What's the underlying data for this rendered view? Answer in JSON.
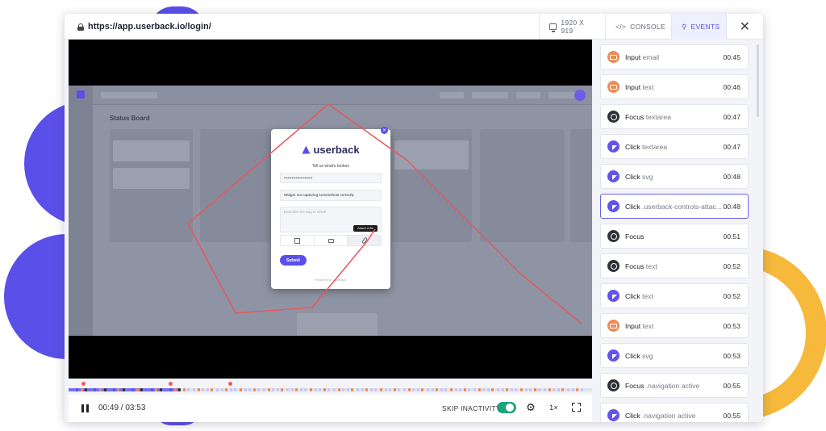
{
  "url": "https://app.userback.io/login/",
  "toolbar": {
    "resolution": "1920 X 919",
    "console": "CONSOLE",
    "events": "EVENTS",
    "close": "✕"
  },
  "widget": {
    "brand": "userback",
    "heading": "Tell us what's broken",
    "email_value": "••••••••••••••••••••••",
    "title_value": "Widget not capturing screenshots correctly",
    "desc_placeholder": "Describe the bug in detail",
    "tooltip": "Attach a file",
    "submit": "Submit",
    "powered": "Powered by Userback"
  },
  "background_app": {
    "title": "Status Board"
  },
  "player": {
    "time": "00:49 / 03:53",
    "skip_label": "SKIP INACTIVITY",
    "skip_on": true,
    "speed": "1×",
    "progress": 0.21
  },
  "events": [
    {
      "type": "input",
      "action": "Input",
      "target": "email",
      "time": "00:45"
    },
    {
      "type": "input",
      "action": "Input",
      "target": "text",
      "time": "00:46"
    },
    {
      "type": "focus",
      "action": "Focus",
      "target": "textarea",
      "time": "00:47"
    },
    {
      "type": "click",
      "action": "Click",
      "target": "textarea",
      "time": "00:47"
    },
    {
      "type": "click",
      "action": "Click",
      "target": "svg",
      "time": "00:48"
    },
    {
      "type": "click",
      "action": "Click",
      "target": ".userback-controls-attac...",
      "time": "00:48",
      "selected": true
    },
    {
      "type": "focus",
      "action": "Focus",
      "target": "",
      "time": "00:51"
    },
    {
      "type": "focus",
      "action": "Focus",
      "target": "text",
      "time": "00:52"
    },
    {
      "type": "click",
      "action": "Click",
      "target": "text",
      "time": "00:52"
    },
    {
      "type": "input",
      "action": "Input",
      "target": "text",
      "time": "00:53"
    },
    {
      "type": "click",
      "action": "Click",
      "target": "svg",
      "time": "00:53"
    },
    {
      "type": "focus",
      "action": "Focus",
      "target": ".navigation active",
      "time": "00:55"
    },
    {
      "type": "click",
      "action": "Click",
      "target": ".navigation active",
      "time": "00:55"
    }
  ],
  "colors": {
    "accent": "#5b4fe9",
    "input_event": "#f08a54",
    "focus_event": "#2e3138",
    "click_event": "#6254e8",
    "toggle_on": "#1ea37a",
    "cursor_path": "#e8565f",
    "highlight_yellow": "#f6b93b"
  }
}
